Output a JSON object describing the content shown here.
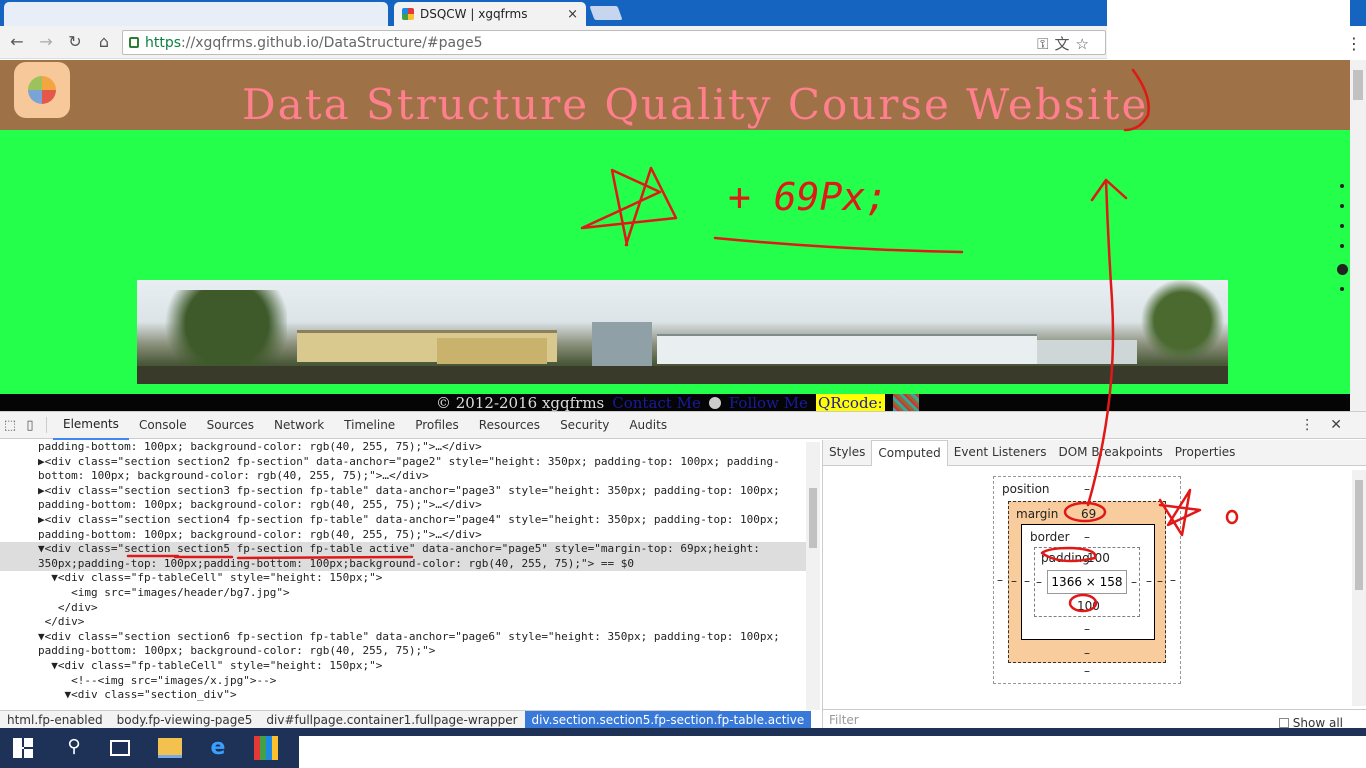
{
  "browser": {
    "tab": {
      "title": "DSQCW | xgqfrms",
      "close": "×"
    },
    "nav": {
      "back": "←",
      "forward": "→",
      "reload": "↻",
      "home": "⌂"
    },
    "address": {
      "https": "https",
      "rest": "://xgqfrms.github.io/DataStructure/#page5"
    },
    "icons": [
      "key-icon",
      "translate-icon",
      "star-icon"
    ],
    "menu": "⋮"
  },
  "site": {
    "title": "Data Structure Quality Course Website",
    "footer": {
      "copyright": "© 2012-2016 xgqfrms",
      "contact": "Contact Me",
      "follow": "Follow Me",
      "qrcode": "QRcode:"
    },
    "colors": {
      "header": "#9e7146",
      "section_bg": "#23ff4b",
      "title": "#ff7f8e"
    }
  },
  "devtools": {
    "tabs": [
      "Elements",
      "Console",
      "Sources",
      "Network",
      "Timeline",
      "Profiles",
      "Resources",
      "Security",
      "Audits"
    ],
    "elements_lines": [
      "padding-bottom: 100px; background-color: rgb(40, 255, 75);\">…</div>",
      "▶<div class=\"section section2 fp-section\" data-anchor=\"page2\" style=\"height: 350px; padding-top: 100px; padding-",
      "bottom: 100px; background-color: rgb(40, 255, 75);\">…</div>",
      "▶<div class=\"section section3 fp-section fp-table\" data-anchor=\"page3\" style=\"height: 350px; padding-top: 100px;",
      "padding-bottom: 100px; background-color: rgb(40, 255, 75);\">…</div>",
      "▶<div class=\"section section4 fp-section fp-table\" data-anchor=\"page4\" style=\"height: 350px; padding-top: 100px;",
      "padding-bottom: 100px; background-color: rgb(40, 255, 75);\">…</div>",
      "▼<div class=\"section section5 fp-section fp-table active\" data-anchor=\"page5\" style=\"margin-top: 69px;height:",
      "350px;padding-top: 100px;padding-bottom: 100px;background-color: rgb(40, 255, 75);\"> == $0",
      "  ▼<div class=\"fp-tableCell\" style=\"height: 150px;\">",
      "     <img src=\"images/header/bg7.jpg\">",
      "   </div>",
      " </div>",
      "▼<div class=\"section section6 fp-section fp-table\" data-anchor=\"page6\" style=\"height: 350px; padding-top: 100px;",
      "padding-bottom: 100px; background-color: rgb(40, 255, 75);\">",
      "  ▼<div class=\"fp-tableCell\" style=\"height: 150px;\">",
      "     <!--<img src=\"images/x.jpg\">-->",
      "    ▼<div class=\"section_div\">"
    ],
    "breadcrumbs": [
      "html.fp-enabled",
      "body.fp-viewing-page5",
      "div#fullpage.container1.fullpage-wrapper",
      "div.section.section5.fp-section.fp-table.active"
    ],
    "side_tabs": [
      "Styles",
      "Computed",
      "Event Listeners",
      "DOM Breakpoints",
      "Properties"
    ],
    "box_model": {
      "position_label": "position",
      "position_value": "–",
      "margin_label": "margin",
      "margin_top": "69",
      "margin_other": "–",
      "border_label": "border",
      "border_value": "–",
      "padding_label": "padding",
      "padding_top": "100",
      "padding_bottom": "100",
      "padding_side": "–",
      "content": "1366 × 158"
    },
    "filter_placeholder": "Filter",
    "show_all": "Show all"
  },
  "annotations": {
    "handwritten": "+ 69Px;",
    "small_o": "o"
  }
}
